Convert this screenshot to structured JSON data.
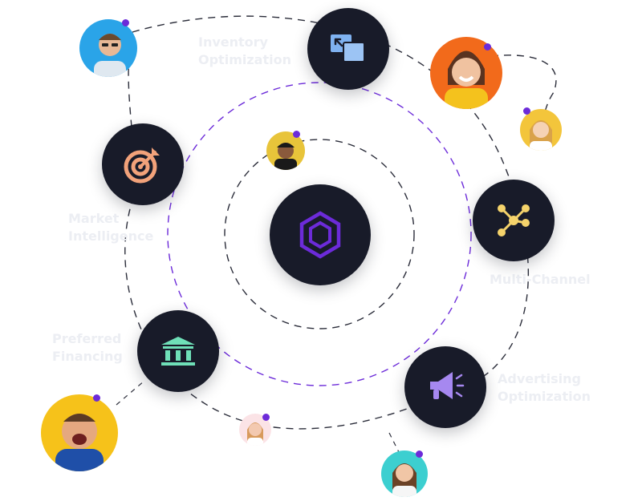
{
  "colors": {
    "node_bg": "#181b29",
    "orbit_purple": "#6c2bd9",
    "orbit_gray": "#2b2d3a",
    "label_text": "#eceef3",
    "presence_dot": "#6c2bd9"
  },
  "hub": {
    "icon": "hexagon-logo-icon"
  },
  "features": [
    {
      "id": "inventory",
      "label": "Inventory\nOptimization",
      "icon": "copy-squares-icon",
      "icon_color": "#7fb2f0"
    },
    {
      "id": "market",
      "label": "Market\nIntelligence",
      "icon": "target-arrow-icon",
      "icon_color": "#f2a27a"
    },
    {
      "id": "multichannel",
      "label": "Multi-Channel",
      "icon": "network-nodes-icon",
      "icon_color": "#f5d36b"
    },
    {
      "id": "financing",
      "label": "Preferred\nFinancing",
      "icon": "bank-building-icon",
      "icon_color": "#6fe0b8"
    },
    {
      "id": "advertising",
      "label": "Advertising\nOptimization",
      "icon": "megaphone-icon",
      "icon_color": "#a688f0"
    }
  ],
  "avatars": [
    {
      "name": "avatar-man-glasses",
      "bg": "#2aa4e8",
      "skin": "#e8b896",
      "shirt": "#dfe8f0"
    },
    {
      "name": "avatar-woman-orange",
      "bg": "#f26a1b",
      "skin": "#f0c2a0",
      "shirt": "#f4c21d"
    },
    {
      "name": "avatar-woman-blonde",
      "bg": "#f3c53b",
      "skin": "#f5d2b5",
      "shirt": "#ffffff"
    },
    {
      "name": "avatar-man-cap",
      "bg": "#e8c43a",
      "skin": "#8a5a3c",
      "shirt": "#1a1a1a"
    },
    {
      "name": "avatar-man-laughing",
      "bg": "#f6c21a",
      "skin": "#e5a880",
      "shirt": "#1f4fa8"
    },
    {
      "name": "avatar-woman-small",
      "bg": "#fbe3e6",
      "skin": "#f3c9b0",
      "shirt": "#ffffff"
    },
    {
      "name": "avatar-woman-teal",
      "bg": "#3ccfd0",
      "skin": "#f1c6a6",
      "shirt": "#f6f6f6"
    }
  ]
}
